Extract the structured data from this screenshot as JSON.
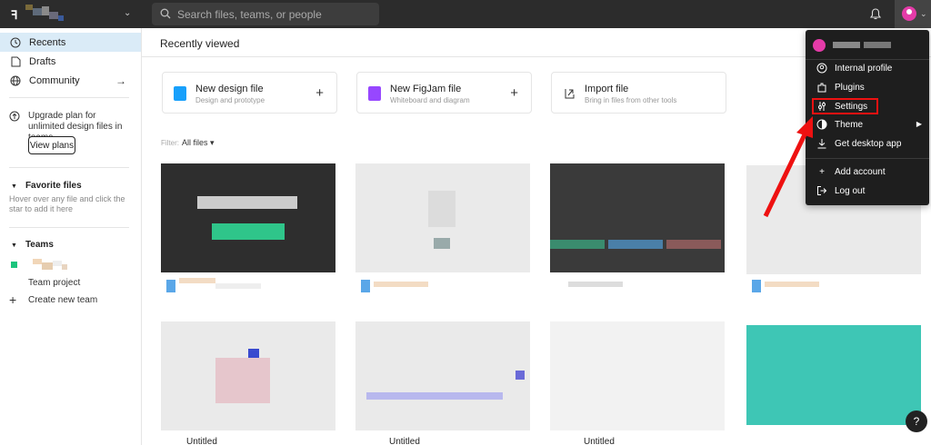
{
  "topbar": {
    "logo": "ꟻ",
    "search_placeholder": "Search files, teams, or people"
  },
  "sidebar": {
    "items": [
      {
        "label": "Recents"
      },
      {
        "label": "Drafts"
      },
      {
        "label": "Community"
      }
    ],
    "upgrade_text": "Upgrade plan for unlimited design files in teams",
    "view_plans": "View plans",
    "favorite_files": "Favorite files",
    "favorite_hint": "Hover over any file and click the star to add it here",
    "teams": "Teams",
    "team_project": "Team project",
    "create_team": "Create new team"
  },
  "main": {
    "title": "Recently viewed",
    "cards": [
      {
        "title": "New design file",
        "subtitle": "Design and prototype",
        "color": "#18a0fb"
      },
      {
        "title": "New FigJam file",
        "subtitle": "Whiteboard and diagram",
        "color": "#9747ff"
      },
      {
        "title": "Import file",
        "subtitle": "Bring in files from other tools",
        "color": "#ffffff"
      }
    ],
    "filter_label": "Filter:",
    "filter_value": "All files ▾",
    "untitled": [
      "Untitled",
      "Untitled",
      "Untitled"
    ]
  },
  "menu": {
    "items": [
      {
        "label": "Internal profile"
      },
      {
        "label": "Plugins"
      },
      {
        "label": "Settings"
      },
      {
        "label": "Theme"
      },
      {
        "label": "Get desktop app"
      },
      {
        "label": "Add account"
      },
      {
        "label": "Log out"
      }
    ]
  },
  "help": "?"
}
